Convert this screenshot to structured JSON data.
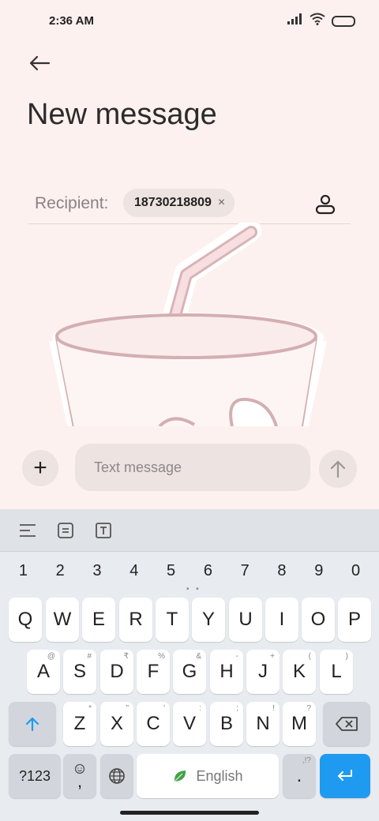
{
  "status_bar": {
    "time": "2:36 AM"
  },
  "header": {
    "title": "New message"
  },
  "recipient": {
    "label": "Recipient:",
    "chip": "18730218809",
    "chip_remove": "×"
  },
  "compose": {
    "placeholder": "Text message",
    "add": "+"
  },
  "keyboard": {
    "numbers": [
      "1",
      "2",
      "3",
      "4",
      "5",
      "6",
      "7",
      "8",
      "9",
      "0"
    ],
    "row1": [
      "Q",
      "W",
      "E",
      "R",
      "T",
      "Y",
      "U",
      "I",
      "O",
      "P"
    ],
    "row2": [
      "A",
      "S",
      "D",
      "F",
      "G",
      "H",
      "J",
      "K",
      "L"
    ],
    "row2_hints": [
      "@",
      "#",
      "₹",
      "%",
      "&",
      "-",
      "+",
      "(",
      ")"
    ],
    "row3": [
      "Z",
      "X",
      "C",
      "V",
      "B",
      "N",
      "M"
    ],
    "row3_hints": [
      "*",
      "\"",
      "'",
      ":",
      ";",
      "!",
      "?"
    ],
    "symbols_key": "?123",
    "comma_key": ",",
    "space_label": "English",
    "period_key": ".",
    "period_hint": ",!?",
    "dots": "• •"
  },
  "colors": {
    "background": "#fdf1ef",
    "accent": "#1e9bf0",
    "keyboard": "#e8ebef"
  }
}
